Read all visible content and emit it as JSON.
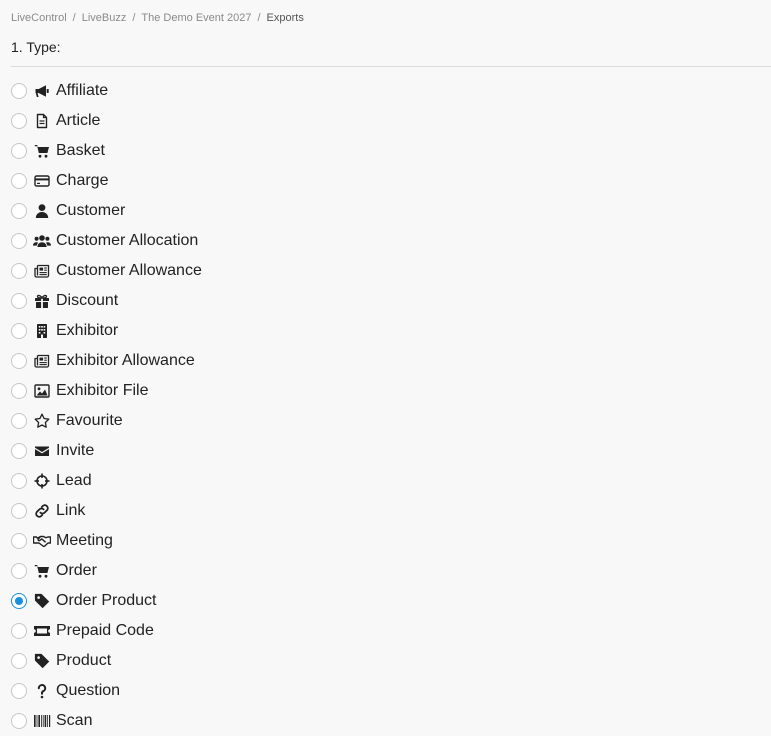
{
  "breadcrumb": {
    "items": [
      "LiveControl",
      "LiveBuzz",
      "The Demo Event 2027",
      "Exports"
    ],
    "separator": "/"
  },
  "section": {
    "title": "1. Type:"
  },
  "accent_color": "#1a8fe0",
  "options": [
    {
      "label": "Affiliate",
      "icon": "megaphone-icon",
      "checked": false
    },
    {
      "label": "Article",
      "icon": "file-text-icon",
      "checked": false
    },
    {
      "label": "Basket",
      "icon": "cart-icon",
      "checked": false
    },
    {
      "label": "Charge",
      "icon": "credit-card-icon",
      "checked": false
    },
    {
      "label": "Customer",
      "icon": "user-icon",
      "checked": false
    },
    {
      "label": "Customer Allocation",
      "icon": "users-icon",
      "checked": false
    },
    {
      "label": "Customer Allowance",
      "icon": "newspaper-icon",
      "checked": false
    },
    {
      "label": "Discount",
      "icon": "gift-icon",
      "checked": false
    },
    {
      "label": "Exhibitor",
      "icon": "building-icon",
      "checked": false
    },
    {
      "label": "Exhibitor Allowance",
      "icon": "newspaper-icon",
      "checked": false
    },
    {
      "label": "Exhibitor File",
      "icon": "image-icon",
      "checked": false
    },
    {
      "label": "Favourite",
      "icon": "star-icon",
      "checked": false
    },
    {
      "label": "Invite",
      "icon": "envelope-icon",
      "checked": false
    },
    {
      "label": "Lead",
      "icon": "crosshairs-icon",
      "checked": false
    },
    {
      "label": "Link",
      "icon": "link-icon",
      "checked": false
    },
    {
      "label": "Meeting",
      "icon": "handshake-icon",
      "checked": false
    },
    {
      "label": "Order",
      "icon": "cart-icon",
      "checked": false
    },
    {
      "label": "Order Product",
      "icon": "tag-icon",
      "checked": true
    },
    {
      "label": "Prepaid Code",
      "icon": "ticket-icon",
      "checked": false
    },
    {
      "label": "Product",
      "icon": "tag-icon",
      "checked": false
    },
    {
      "label": "Question",
      "icon": "question-icon",
      "checked": false
    },
    {
      "label": "Scan",
      "icon": "barcode-icon",
      "checked": false
    }
  ]
}
